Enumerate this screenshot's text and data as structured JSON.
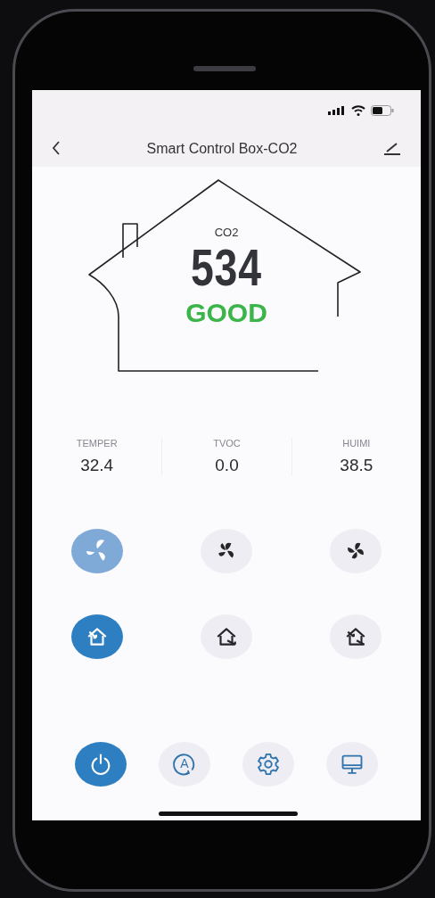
{
  "header": {
    "title": "Smart Control Box-CO2"
  },
  "main_reading": {
    "label": "CO2",
    "value": "534",
    "status": "GOOD",
    "color": "#3bb54a"
  },
  "readings": [
    {
      "label": "TEMPER",
      "value": "32.4"
    },
    {
      "label": "TVOC",
      "value": "0.0"
    },
    {
      "label": "HUIMI",
      "value": "38.5"
    }
  ],
  "fan_speeds": [
    {
      "kind": "fan-low",
      "selected": true
    },
    {
      "kind": "fan-mid",
      "selected": false
    },
    {
      "kind": "fan-high",
      "selected": false
    }
  ],
  "modes": [
    {
      "kind": "inflow",
      "selected": true
    },
    {
      "kind": "outflow",
      "selected": false
    },
    {
      "kind": "exchange",
      "selected": false
    }
  ],
  "bottom_bar": [
    {
      "kind": "power",
      "on": true
    },
    {
      "kind": "auto",
      "on": false,
      "letter": "A"
    },
    {
      "kind": "settings",
      "on": false
    },
    {
      "kind": "display",
      "on": false
    }
  ]
}
